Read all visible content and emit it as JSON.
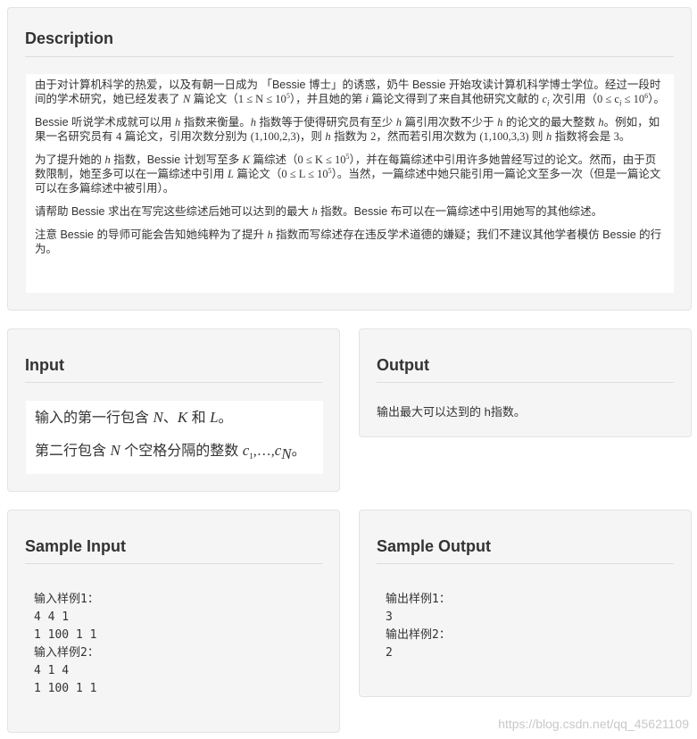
{
  "description": {
    "title": "Description",
    "p1": {
      "a": "由于对计算机科学的热爱，以及有朝一日成为 「Bessie 博士」的诱惑，奶牛 Bessie 开始攻读计算机科学博士学位。经过一段时间的学术研究，她已经发表了 ",
      "var_N": "N",
      "b": " 篇论文（",
      "cond_N": "1 ≤ N ≤ 10",
      "exp5": "5",
      "c": "），并且她的第 ",
      "var_i": "i",
      "d": " 篇论文得到了来自其他研究文献的 ",
      "var_ci": "c",
      "sub_i": "i",
      "e": " 次引用（",
      "cond_c": "0 ≤ c",
      "cond_c2": " ≤ 10",
      "exp6": "6",
      "f": "）。"
    },
    "p2": {
      "a": "Bessie 听说学术成就可以用 ",
      "h1": "h",
      "b": " 指数来衡量。",
      "h2": "h",
      "c": " 指数等于使得研究员有至少 ",
      "h3": "h",
      "d": " 篇引用次数不少于 ",
      "h4": "h",
      "e": " 的论文的最大整数 ",
      "h5": "h",
      "f": "。例如，如果一名研究员有 ",
      "n4": "4",
      "g": " 篇论文，引用次数分别为 ",
      "seq1": "(1,100,2,3)",
      "h": "，则 ",
      "h6": "h",
      "i": " 指数为 ",
      "n2": "2",
      "j": "，然而若引用次数为 ",
      "seq2": "(1,100,3,3)",
      "k": " 则 ",
      "h7": "h",
      "l": " 指数将会是 ",
      "n3": "3",
      "m": "。"
    },
    "p3": {
      "a": "为了提升她的 ",
      "h1": "h",
      "b": " 指数，Bessie 计划写至多 ",
      "var_K": "K",
      "c": " 篇综述（",
      "cond_K": "0 ≤ K ≤ 10",
      "exp5a": "5",
      "d": "），并在每篇综述中引用许多她曾经写过的论文。然而，由于页数限制，她至多可以在一篇综述中引用 ",
      "var_L": "L",
      "e": " 篇论文（",
      "cond_L": "0 ≤ L ≤ 10",
      "exp5b": "5",
      "f": "）。当然，一篇综述中她只能引用一篇论文至多一次（但是一篇论文可以在多篇综述中被引用）。"
    },
    "p4": {
      "a": "请帮助 Bessie 求出在写完这些综述后她可以达到的最大 ",
      "h1": "h",
      "b": " 指数。Bessie 布可以在一篇综述中引用她写的其他综述。"
    },
    "p5": {
      "a": "注意 Bessie 的导师可能会告知她纯粹为了提升 ",
      "h1": "h",
      "b": " 指数而写综述存在违反学术道德的嫌疑；我们不建议其他学者模仿 Bessie 的行为。"
    }
  },
  "input": {
    "title": "Input",
    "line1": {
      "a": "输入的第一行包含 ",
      "N": "N",
      "sep": "、",
      "K": "K",
      "and": " 和 ",
      "L": "L",
      "end": "。"
    },
    "line2": {
      "a": "第二行包含 ",
      "N": "N",
      "b": " 个空格分隔的整数 ",
      "c1": "c",
      "sub1": "1",
      "dots": ",…,",
      "cN": "c",
      "subN": "N",
      "end": "。"
    }
  },
  "output": {
    "title": "Output",
    "text": "输出最大可以达到的 h指数。"
  },
  "sample_input": {
    "title": "Sample Input",
    "lines": [
      "输入样例1：",
      "4 4 1",
      "1 100 1 1",
      "输入样例2：",
      "4 1 4",
      "1 100 1 1"
    ]
  },
  "sample_output": {
    "title": "Sample Output",
    "lines": [
      "输出样例1：",
      "3",
      "输出样例2：",
      "2"
    ]
  },
  "watermark": "https://blog.csdn.net/qq_45621109"
}
